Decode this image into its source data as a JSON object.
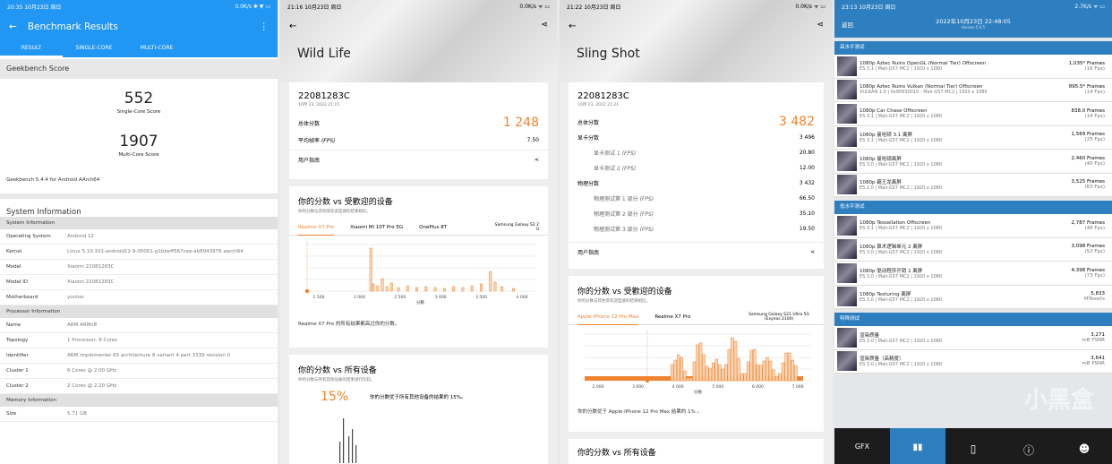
{
  "p1": {
    "status_time": "20:35 10月23日 周日",
    "status_right": "0.0K/s ✱ ▼ ▭",
    "title": "Benchmark Results",
    "tabs": [
      "RESULT",
      "SINGLE-CORE",
      "MULTI-CORE"
    ],
    "gb_header": "Geekbench Score",
    "single": {
      "value": "552",
      "label": "Single-Core Score"
    },
    "multi": {
      "value": "1907",
      "label": "Multi-Core Score"
    },
    "version": "Geekbench 5.4.4 for Android AArch64",
    "sys_header": "System Information",
    "groups": [
      {
        "title": "System Information",
        "rows": [
          [
            "Operating System",
            "Android 12"
          ],
          [
            "Kernel",
            "Linux 5.10.101-android12-9-00001-g1bbeff567cee-ab8943976 aarch64"
          ],
          [
            "Model",
            "Xiaomi 22081283C"
          ],
          [
            "Model ID",
            "Xiaomi 22081283C"
          ],
          [
            "Motherboard",
            "yunluo"
          ]
        ]
      },
      {
        "title": "Processor Information",
        "rows": [
          [
            "Name",
            "ARM ARMv8"
          ],
          [
            "Topology",
            "1 Processor, 8 Cores"
          ],
          [
            "Identifier",
            "ARM implementer 65 architecture 8 variant 4 part 3339 revision 0"
          ],
          [
            "Cluster 1",
            "6 Cores @ 2.00 GHz"
          ],
          [
            "Cluster 2",
            "2 Cores @ 2.20 GHz"
          ]
        ]
      },
      {
        "title": "Memory Information",
        "rows": [
          [
            "Size",
            "5.71 GB"
          ]
        ]
      }
    ]
  },
  "p2": {
    "status_time": "21:16 10月23日 周日",
    "status_right": "0.0K/s ᯤ ▭",
    "title": "Wild Life",
    "device": "22081283C",
    "date": "10月 23, 2022 21:15",
    "total_label": "总体分数",
    "total": "1 248",
    "fps_label": "平均帧率",
    "fps_unit": "(FPS)",
    "fps": "7.50",
    "guide": "用户指南",
    "cmp_title": "你的分数 vs 受歡迎的设备",
    "cmp_sub": "你的分数与其他受欢迎型號的结果相比。",
    "cmp_tabs": [
      "Realme X7 Pro",
      "Xiaomi Mi 10T Pro 5G",
      "OnePlus 8T",
      "Samsung Galaxy S2 2 0"
    ],
    "cmp_note": "Realme X7 Pro 的所有结果都高过你的分数。",
    "xticks": [
      "1 500",
      "2 000",
      "2 500",
      "3 000",
      "3 500",
      "4 000"
    ],
    "xlabel": "分數",
    "all_title": "你的分数 vs 所有设备",
    "all_sub": "你的分数与所有其他设备的结果进行比较。",
    "pct": "15%",
    "pct_text": "你的分数优于所有其他设备的结果的 15%。"
  },
  "p3": {
    "status_time": "21:22 10月23日 周日",
    "status_right": "0.0K/s ᯤ ▭",
    "title": "Sling Shot",
    "device": "22081283C",
    "date": "10月 23, 2022 21:21",
    "total_label": "总体分数",
    "total": "3 482",
    "guide": "用户指南",
    "rows": [
      [
        "显卡分数",
        "",
        "3 496",
        false
      ],
      [
        "显卡测试 1",
        "(FPS)",
        "20.80",
        true
      ],
      [
        "显卡测试 2",
        "(FPS)",
        "12.00",
        true
      ],
      [
        "物理分数",
        "",
        "3 432",
        false
      ],
      [
        "物理测试第 1 部分",
        "(FPS)",
        "66.50",
        true
      ],
      [
        "物理测试第 2 部分",
        "(FPS)",
        "35.10",
        true
      ],
      [
        "物理测试第 3 部分",
        "(FPS)",
        "19.50",
        true
      ]
    ],
    "cmp_title": "你的分数 vs 受歡迎的设备",
    "cmp_sub": "你的分数与其他受欢迎型號的结果相比。",
    "cmp_tabs": [
      "Apple iPhone 12 Pro Max",
      "Realme X7 Pro",
      "Samsung Galaxy S21 Ultra 5G (Exynos 2100)"
    ],
    "cmp_note": "你的分数优于 Apple iPhone 12 Pro Max 结果的 1% 。",
    "xticks": [
      "2 000",
      "3 000",
      "4 000",
      "5 000",
      "6 000",
      "7 000"
    ],
    "xlabel": "分数",
    "bottom": "你的分数 vs 所有设备"
  },
  "p4": {
    "status_time": "23:13 10月23日 周日",
    "status_right": "2.7K/s ᯤ ▭",
    "back": "返回",
    "datetime": "2022年10月23日 22:48:05",
    "version": "Version 5.0.5",
    "sections": [
      {
        "title": "高水平测试",
        "rows": [
          [
            "1080p Aztec Ruins OpenGL (Normal Tier) Offscreen",
            "ES 3.1 | Mali-G57 MC2 | 1920 x 1080",
            "1,035* Frames",
            "(16 Fps)"
          ],
          [
            "1080p Aztec Ruins Vulkan (Normal Tier) Offscreen",
            "VULKAN 1.0 | 0x90930010 - Mali-G57 MC2 | 1920 x 1080",
            "895.5* Frames",
            "(14 Fps)"
          ],
          [
            "1080p Car Chase Offscreen",
            "ES 3.1 | Mali-G57 MC2 | 1920 x 1080",
            "838.0 Frames",
            "(14 Fps)"
          ],
          [
            "1080p 曼哈顿 3.1 离屏",
            "ES 3.1 | Mali-G57 MC2 | 1920 x 1080",
            "1,569 Frames",
            "(25 Fps)"
          ],
          [
            "1080p 曼哈顿离屏",
            "ES 3.0 | Mali-G57 MC2 | 1920 x 1080",
            "2,460 Frames",
            "(40 Fps)"
          ],
          [
            "1080p 霸王龙离屏",
            "ES 2.0 | Mali-G57 MC2 | 1920 x 1080",
            "3,525 Frames",
            "(63 Fps)"
          ]
        ]
      },
      {
        "title": "低水平测试",
        "rows": [
          [
            "1080p Tessellation Offscreen",
            "ES 3.1 | Mali-G57 MC2 | 1920 x 1080",
            "2,787 Frames",
            "(46 Fps)"
          ],
          [
            "1080p 算术逻辑单元 2 离屏",
            "ES 3.0 | Mali-G57 MC2 | 1920 x 1080",
            "3,098 Frames",
            "(52 Fps)"
          ],
          [
            "1080p 驱动程序开销 2 离屏",
            "ES 3.0 | Mali-G57 MC2 | 1920 x 1080",
            "4,398 Frames",
            "(73 Fps)"
          ],
          [
            "1080p Texturing 离屏",
            "ES 3.0 | Mali-G57 MC2 | 1920 x 1080",
            "5,833",
            "MTexel/s"
          ]
        ]
      },
      {
        "title": "特殊测试",
        "rows": [
          [
            "渲染质量",
            "ES 3.0 | Mali-G57 MC2 | 1920 x 1080",
            "3,271",
            "mB PSNR"
          ],
          [
            "渲染质量（高精度）",
            "ES 3.0 | Mali-G57 MC2 | 1920 x 1080",
            "3,641",
            "mB PSNR"
          ]
        ]
      }
    ],
    "tabs": [
      "GFX",
      "▮▮",
      "▯",
      "ⓘ",
      "☻"
    ],
    "watermark": "小黑盒"
  }
}
